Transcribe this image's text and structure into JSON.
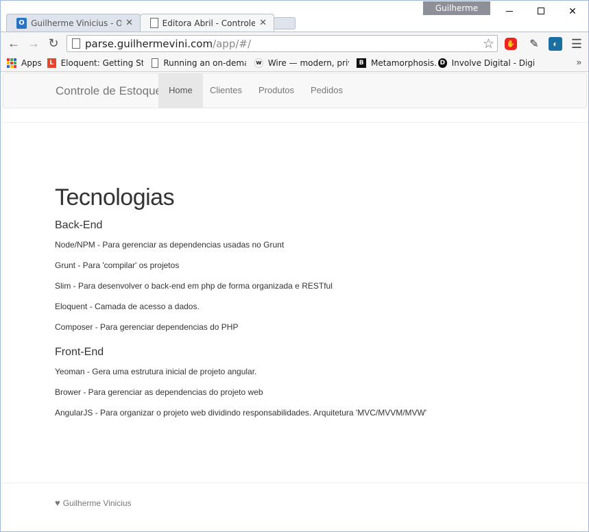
{
  "browser": {
    "profile_name": "Guilherme Vini...",
    "tabs": [
      {
        "title": "Guilherme Vinicius - Outlo",
        "icon": "outlook-icon",
        "active": false
      },
      {
        "title": "Editora Abril - Controle de",
        "icon": "page-icon",
        "active": true
      }
    ],
    "url_host": "parse.guilhermevini.com",
    "url_path": "/app/#/",
    "bookmarks": [
      {
        "label": "Apps",
        "icon": "apps-icon"
      },
      {
        "label": "Eloquent: Getting Star",
        "icon": "laravel-icon"
      },
      {
        "label": "Running an on-demar",
        "icon": "page-icon"
      },
      {
        "label": "Wire — modern, priva",
        "icon": "wire-icon"
      },
      {
        "label": "Metamorphosis.",
        "icon": "b-icon"
      },
      {
        "label": "Involve Digital - Digita",
        "icon": "d-icon"
      }
    ],
    "more_bookmarks": "»"
  },
  "navbar": {
    "brand": "Controle de Estoque",
    "items": [
      "Home",
      "Clientes",
      "Produtos",
      "Pedidos"
    ],
    "active_item": "Home"
  },
  "main": {
    "title": "Tecnologias",
    "sections": [
      {
        "heading": "Back-End",
        "items": [
          "Node/NPM - Para gerenciar as dependencias usadas no Grunt",
          "Grunt - Para 'compilar' os projetos",
          "Slim - Para desenvolver o back-end em php de forma organizada e RESTful",
          "Eloquent - Camada de acesso a dados.",
          "Composer - Para gerenciar dependencias do PHP"
        ]
      },
      {
        "heading": "Front-End",
        "items": [
          "Yeoman - Gera uma estrutura inicial de projeto angular.",
          "Brower - Para gerenciar as dependencias do projeto web",
          "AngularJS - Para organizar o projeto web dividindo responsabilidades. Arquitetura 'MVC/MVVM/MVW'"
        ]
      }
    ]
  },
  "footer": {
    "author": "Guilherme Vinicius"
  },
  "colors": {
    "navbar_bg": "#f8f8f8",
    "active_nav_bg": "#e7e7e7",
    "text": "#333333",
    "muted": "#777777"
  }
}
